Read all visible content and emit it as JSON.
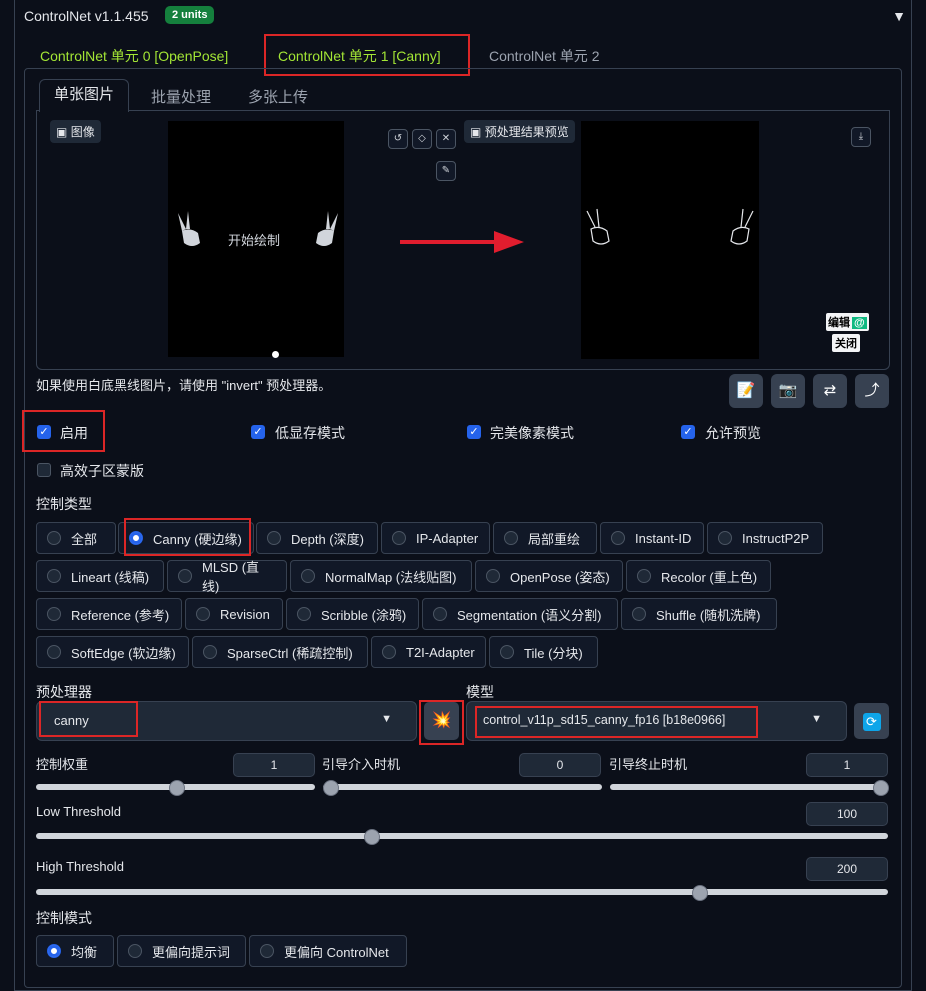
{
  "header": {
    "title": "ControlNet v1.1.455",
    "badge": "2 units"
  },
  "unit_tabs": [
    "ControlNet 单元 0 [OpenPose]",
    "ControlNet 单元 1 [Canny]",
    "ControlNet 单元 2"
  ],
  "sub_tabs": [
    "单张图片",
    "批量处理",
    "多张上传"
  ],
  "image_panel": {
    "label": "图像",
    "canvas_text": "开始绘制"
  },
  "preview_panel": {
    "label": "预处理结果预览",
    "edit": "编辑",
    "close": "关闭"
  },
  "hint": "如果使用白底黑线图片，请使用 \"invert\" 预处理器。",
  "checkboxes": [
    {
      "label": "启用",
      "checked": true
    },
    {
      "label": "低显存模式",
      "checked": true
    },
    {
      "label": "完美像素模式",
      "checked": true
    },
    {
      "label": "允许预览",
      "checked": true
    },
    {
      "label": "高效子区蒙版",
      "checked": false
    }
  ],
  "control_type": {
    "label": "控制类型",
    "rows": [
      [
        "全部",
        "Canny (硬边缘)",
        "Depth (深度)",
        "IP-Adapter",
        "局部重绘",
        "Instant-ID",
        "InstructP2P"
      ],
      [
        "Lineart (线稿)",
        "MLSD (直线)",
        "NormalMap (法线贴图)",
        "OpenPose (姿态)",
        "Recolor (重上色)"
      ],
      [
        "Reference (参考)",
        "Revision",
        "Scribble (涂鸦)",
        "Segmentation (语义分割)",
        "Shuffle (随机洗牌)"
      ],
      [
        "SoftEdge (软边缘)",
        "SparseCtrl (稀疏控制)",
        "T2I-Adapter",
        "Tile (分块)"
      ]
    ],
    "selected": "Canny (硬边缘)"
  },
  "preprocessor": {
    "label": "预处理器",
    "value": "canny"
  },
  "model": {
    "label": "模型",
    "value": "control_v11p_sd15_canny_fp16 [b18e0966]"
  },
  "sliders": {
    "weight": {
      "label": "控制权重",
      "value": "1",
      "fraction": 0.5
    },
    "start": {
      "label": "引导介入时机",
      "value": "0",
      "fraction": 0.0
    },
    "end": {
      "label": "引导终止时机",
      "value": "1",
      "fraction": 1.0
    },
    "low": {
      "label": "Low Threshold",
      "value": "100",
      "fraction": 0.392
    },
    "high": {
      "label": "High Threshold",
      "value": "200",
      "fraction": 0.784
    }
  },
  "control_mode": {
    "label": "控制模式",
    "options": [
      "均衡",
      "更偏向提示词",
      "更偏向 ControlNet"
    ],
    "selected": "均衡"
  },
  "colors": {
    "accent": "#2563eb",
    "green_tab": "#a3e635",
    "highlight": "#dc2626",
    "arrow": "#e11d2e"
  }
}
